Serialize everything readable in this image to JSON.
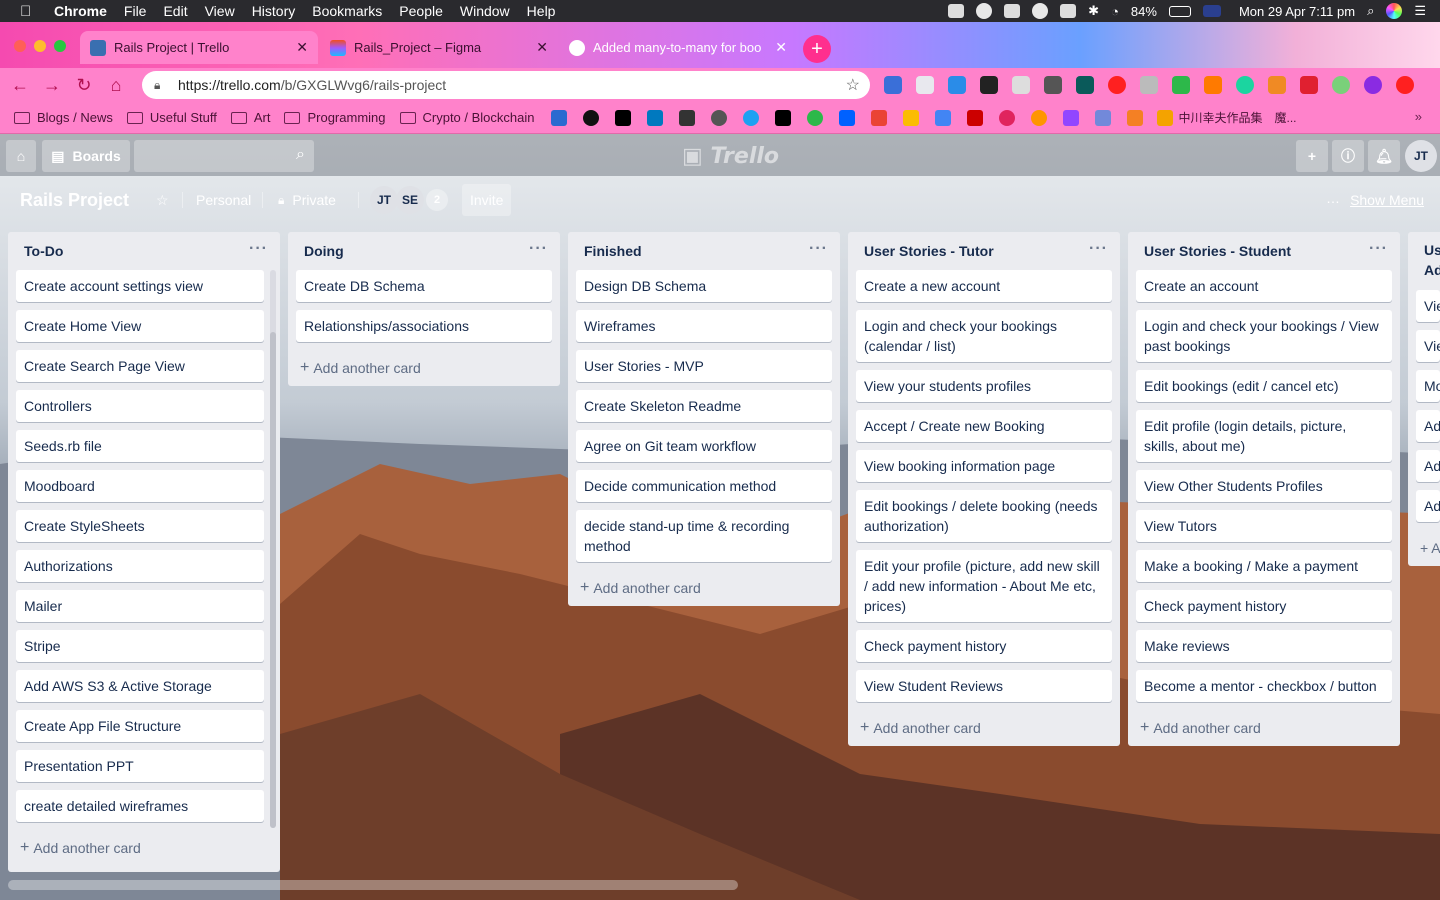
{
  "menubar": {
    "app": "Chrome",
    "items": [
      "File",
      "Edit",
      "View",
      "History",
      "Bookmarks",
      "People",
      "Window",
      "Help"
    ],
    "battery": "84%",
    "datetime": "Mon 29 Apr  7:11 pm"
  },
  "tabs": [
    {
      "title": "Rails Project | Trello"
    },
    {
      "title": "Rails_Project – Figma"
    },
    {
      "title": "Added many-to-many for boo"
    }
  ],
  "toolbar": {
    "url_prefix": "https://trello.com",
    "url_path": "/b/GXGLWvg6/rails-project"
  },
  "bookmarks": [
    "Blogs / News",
    "Useful Stuff",
    "Art",
    "Programming",
    "Crypto / Blockchain"
  ],
  "bookmarks_tail": "中川幸夫作品集　魔...",
  "header": {
    "boards_label": "Boards",
    "logo": "Trello",
    "user_initials": "JT"
  },
  "board": {
    "title": "Rails Project",
    "team": "Personal",
    "visibility": "Private",
    "members": [
      "JT",
      "SE"
    ],
    "member_count": "2",
    "invite": "Invite",
    "show_menu": "Show Menu"
  },
  "lists": [
    {
      "title": "To-Do",
      "cards": [
        "Create account settings view",
        "Create Home View",
        "Create Search Page View",
        "Controllers",
        "Seeds.rb file",
        "Moodboard",
        "Create StyleSheets",
        "Authorizations",
        "Mailer",
        "Stripe",
        "Add AWS S3 & Active Storage",
        "Create App File Structure",
        "Presentation PPT",
        "create detailed wireframes"
      ],
      "add": "Add another card"
    },
    {
      "title": "Doing",
      "cards": [
        "Create DB Schema",
        "Relationships/associations"
      ],
      "add": "Add another card"
    },
    {
      "title": "Finished",
      "cards": [
        "Design DB Schema",
        "Wireframes",
        "User Stories - MVP",
        "Create Skeleton Readme",
        "Agree on Git team workflow",
        "Decide communication method",
        "decide stand-up time & recording method"
      ],
      "add": "Add another card"
    },
    {
      "title": "User Stories - Tutor",
      "cards": [
        "Create a new account",
        "Login and check your bookings (calendar / list)",
        "View your students profiles",
        "Accept / Create new Booking",
        "View booking information page",
        "Edit bookings / delete booking (needs authorization)",
        "Edit your profile (picture, add new skill / add new information - About Me etc, prices)",
        "Check payment history",
        "View Student Reviews"
      ],
      "add": "Add another card"
    },
    {
      "title": "User Stories - Student",
      "cards": [
        "Create an account",
        "Login and check your bookings / View past bookings",
        "Edit bookings (edit / cancel etc)",
        "Edit profile (login details, picture, skills, about me)",
        "View Other Students Profiles",
        "View Tutors",
        "Make a booking / Make a payment",
        "Check payment history",
        "Make reviews",
        "Become a mentor - checkbox / button"
      ],
      "add": "Add another card"
    },
    {
      "title": "Us Ad",
      "cards": [
        "Vie",
        "Vie",
        "Mo",
        "Ad",
        "Ad",
        "Ad"
      ],
      "add": "+ A"
    }
  ]
}
